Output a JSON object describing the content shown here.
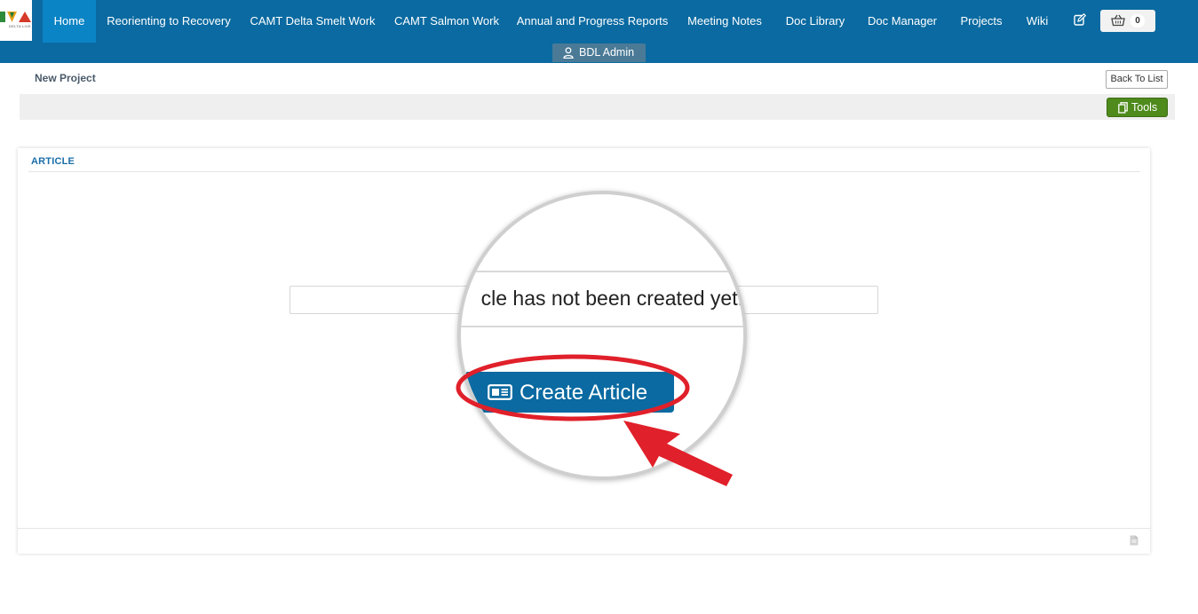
{
  "brand": {
    "logo_tagline": "DELTA LIVE"
  },
  "nav": {
    "items": [
      {
        "label": "Home"
      },
      {
        "label": "Reorienting to Recovery"
      },
      {
        "label": "CAMT Delta Smelt Work"
      },
      {
        "label": "CAMT Salmon Work"
      },
      {
        "label": "Annual and Progress Reports"
      },
      {
        "label": "Meeting Notes"
      },
      {
        "label": "Doc Library"
      },
      {
        "label": "Doc Manager"
      },
      {
        "label": "Projects"
      },
      {
        "label": "Wiki"
      }
    ],
    "active_item": "Home",
    "edit_icon": "edit-icon",
    "cart_icon": "basket-icon",
    "cart_count": "0",
    "user_label": "BDL Admin",
    "user_icon": "user-icon"
  },
  "page": {
    "title": "New Project",
    "back_label": "Back To List",
    "tools_label": "Tools",
    "tools_icon": "copy-icon"
  },
  "panel": {
    "title": "ARTICLE",
    "footer_icon": "document-icon"
  },
  "callout": {
    "message": "cle has not been created yet.",
    "button_label": "Create Article",
    "button_icon": "article-card-icon",
    "highlight_color": "#e0202a"
  },
  "colors": {
    "nav_bg": "#0a6aa1",
    "nav_active": "#0b84c6",
    "tools_green": "#4e8a1c",
    "panel_title": "#1a6ea8"
  }
}
